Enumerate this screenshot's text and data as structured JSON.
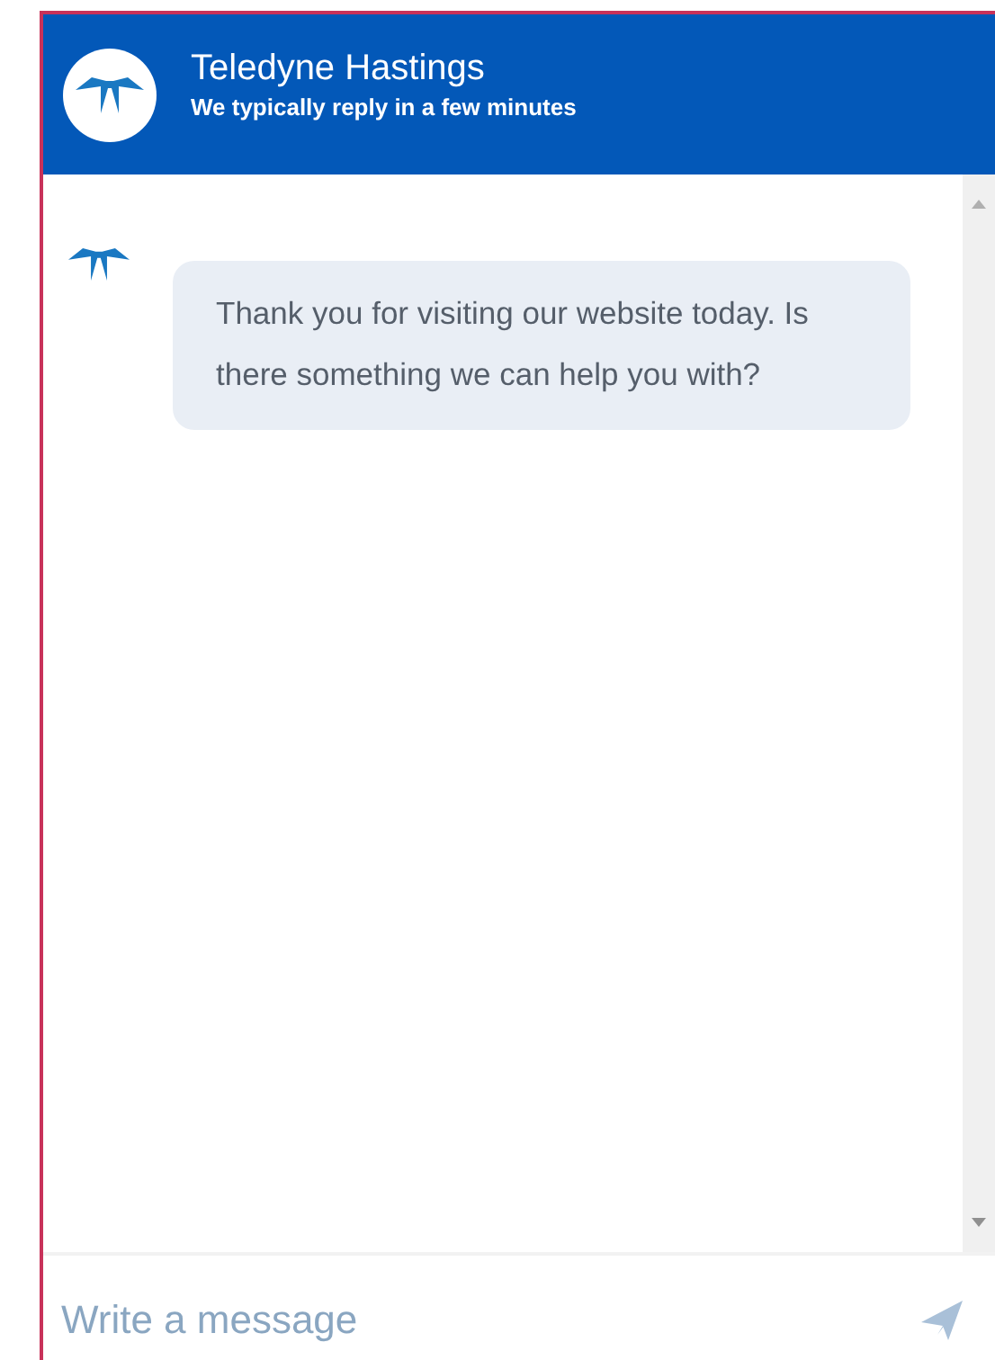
{
  "header": {
    "title": "Teledyne Hastings",
    "subtitle": "We typically reply in a few minutes"
  },
  "messages": [
    {
      "text": "Thank you for visiting our website today.  Is there something we can help you with?"
    }
  ],
  "composer": {
    "placeholder": "Write a message"
  }
}
